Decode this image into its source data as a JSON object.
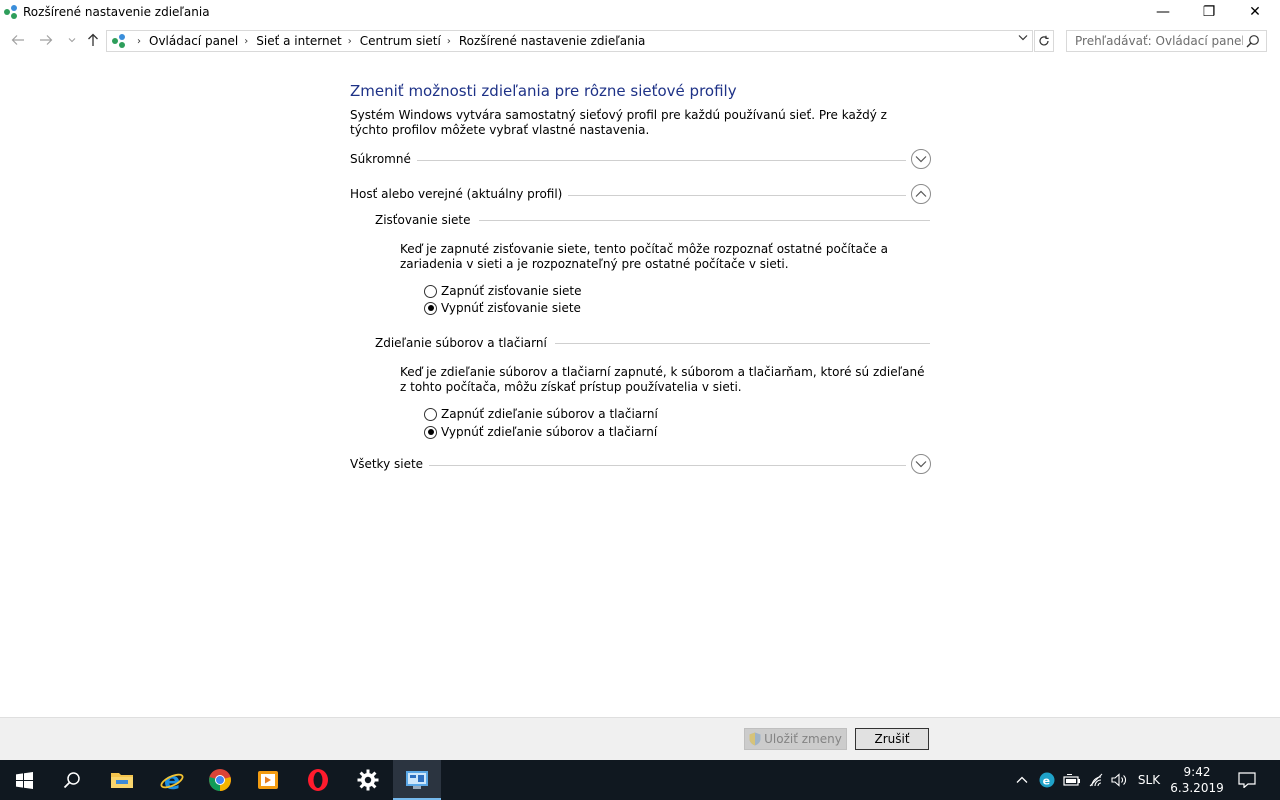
{
  "window": {
    "title": "Rozšírené nastavenie zdieľania",
    "minimize_glyph": "—",
    "restore_glyph": "❐",
    "close_glyph": "✕"
  },
  "address": {
    "breadcrumbs": [
      "Ovládací panel",
      "Sieť a internet",
      "Centrum sietí",
      "Rozšírené nastavenie zdieľania"
    ],
    "search_placeholder": "Prehľadávať: Ovládací panel"
  },
  "content": {
    "title": "Zmeniť možnosti zdieľania pre rôzne sieťové profily",
    "intro": "Systém Windows vytvára samostatný sieťový profil pre každú používanú sieť. Pre každý z týchto profilov môžete vybrať vlastné nastavenia.",
    "profiles": {
      "private": {
        "label": "Súkromné",
        "expanded": false
      },
      "guest_public": {
        "label": "Hosť alebo verejné (aktuálny profil)",
        "expanded": true
      },
      "all_networks": {
        "label": "Všetky siete",
        "expanded": false
      }
    },
    "network_discovery": {
      "heading": "Zisťovanie siete",
      "description": "Keď je zapnuté zisťovanie siete, tento počítač môže rozpoznať ostatné počítače a zariadenia v sieti a je rozpoznateľný pre ostatné počítače v sieti.",
      "options": [
        "Zapnúť zisťovanie siete",
        "Vypnúť zisťovanie siete"
      ],
      "selected_index": 1
    },
    "file_printer_sharing": {
      "heading": "Zdieľanie súborov a tlačiarní",
      "description": "Keď je zdieľanie súborov a tlačiarní zapnuté, k súborom a tlačiarňam, ktoré sú zdieľané z tohto počítača, môžu získať prístup používatelia v sieti.",
      "options": [
        "Zapnúť zdieľanie súborov a tlačiarní",
        "Vypnúť zdieľanie súborov a tlačiarní"
      ],
      "selected_index": 1
    }
  },
  "footer": {
    "save_label": "Uložiť zmeny",
    "save_enabled": false,
    "cancel_label": "Zrušiť"
  },
  "taskbar": {
    "apps": [
      "start-icon",
      "search-icon",
      "file-explorer-icon",
      "internet-explorer-icon",
      "chrome-icon",
      "media-player-icon",
      "opera-icon",
      "settings-icon",
      "control-panel-icon"
    ],
    "active_app": "control-panel-icon",
    "language": "SLK",
    "time": "9:42",
    "date": "6.3.2019"
  },
  "colors": {
    "title_blue": "#1e3287",
    "taskbar_bg": "#101820",
    "taskbar_accent": "#76b9ed"
  }
}
